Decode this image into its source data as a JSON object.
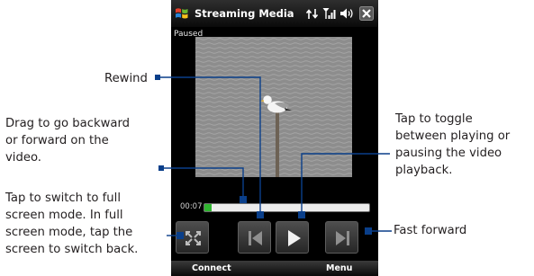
{
  "app": {
    "title": "Streaming Media",
    "status": "Paused"
  },
  "player": {
    "elapsed": "00:07",
    "progress_fraction": 0.045
  },
  "softkeys": {
    "left": "Connect",
    "right": "Menu"
  },
  "annotations": {
    "rewind": "Rewind",
    "drag": [
      "Drag to go backward",
      "or forward on the",
      "video."
    ],
    "fullscreen": [
      "Tap to switch to full",
      "screen mode. In full",
      "screen mode, tap the",
      "screen to switch back."
    ],
    "toggle": [
      "Tap to toggle",
      "between playing or",
      "pausing the video",
      "playback."
    ],
    "fast_forward": "Fast forward"
  },
  "icons": [
    "windows-logo-icon",
    "connectivity-icon",
    "signal-icon",
    "speaker-icon",
    "close-icon",
    "fullscreen-icon",
    "previous-icon",
    "play-icon",
    "next-icon"
  ],
  "colors": {
    "callout_line": "#0a3f8a",
    "progress_fill": "#2fb52f"
  }
}
